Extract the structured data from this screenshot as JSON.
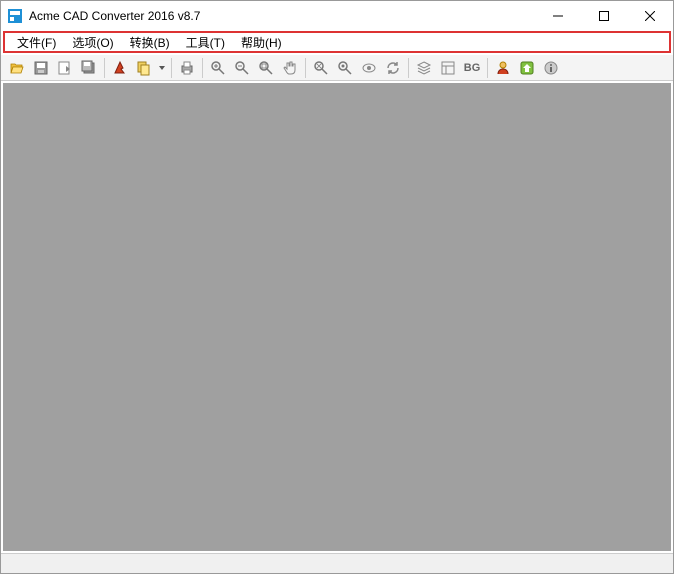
{
  "title": "Acme CAD Converter 2016 v8.7",
  "menu": {
    "file": "文件(F)",
    "options": "选项(O)",
    "convert": "转换(B)",
    "tools": "工具(T)",
    "help": "帮助(H)"
  },
  "toolbar": {
    "bg_label": "BG"
  }
}
